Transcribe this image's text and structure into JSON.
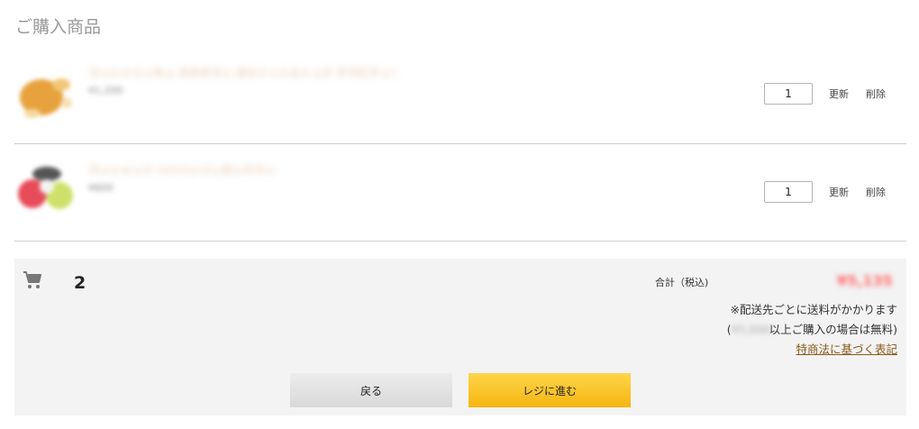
{
  "page": {
    "title": "ご購入商品"
  },
  "items": [
    {
      "name": "ラッシャリッキュ ホホホラッ ボルトントルトック チラピクッチュ",
      "price": "¥1,200",
      "quantity": "1",
      "update_label": "更新",
      "delete_label": "削除"
    },
    {
      "name": "ラッシャッツ バイバッツンガックラッ",
      "price": "¥600",
      "quantity": "1",
      "update_label": "更新",
      "delete_label": "削除"
    }
  ],
  "summary": {
    "item_count": "2",
    "total_label": "合計（税込)",
    "total_value": "¥5,135",
    "shipping_note": "※配送先ごとに送料がかかります",
    "free_shipping": {
      "prefix": "(",
      "amount": "¥5,000",
      "suffix": "以上ご購入の場合は無料)"
    },
    "law_link": "特商法に基づく表記"
  },
  "actions": {
    "back_label": "戻る",
    "checkout_label": "レジに進む"
  },
  "colors": {
    "checkout": "#f5b50f",
    "total": "#ff6b6b",
    "link": "#8a5a1a"
  }
}
